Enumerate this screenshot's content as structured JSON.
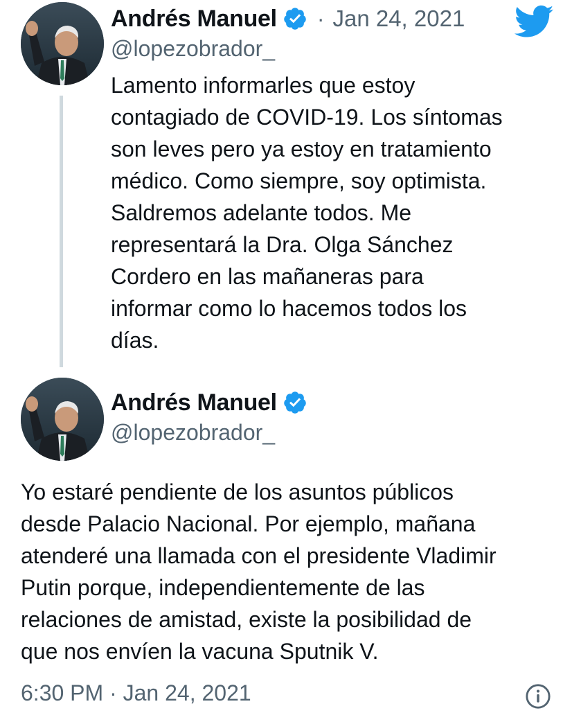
{
  "tweets": [
    {
      "display_name": "Andrés Manuel",
      "verified": true,
      "separator": "·",
      "date": "Jan 24, 2021",
      "handle": "@lopezobrador_",
      "avatar": "avatar-photo",
      "text": "Lamento informarles que estoy\ncontagiado de COVID-19. Los síntomas\nson leves pero ya estoy en tratamiento\nmédico. Como siempre, soy optimista.\nSaldremos adelante todos. Me\nrepresentará la Dra. Olga Sánchez\nCordero en las mañaneras para\ninformar como lo hacemos todos los\ndías."
    },
    {
      "display_name": "Andrés Manuel",
      "verified": true,
      "handle": "@lopezobrador_",
      "avatar": "avatar-photo",
      "text": "Yo estaré pendiente de los asuntos públicos\ndesde Palacio Nacional. Por ejemplo, mañana\natenderé una llamada con el presidente Vladimir\nPutin porque, independientemente de las\nrelaciones de amistad, existe la posibilidad de\nque nos envíen la vacuna Sputnik V."
    }
  ],
  "footer": {
    "timestamp": "6:30 PM · Jan 24, 2021"
  },
  "icons": {
    "brand": "twitter-bird-icon",
    "verified": "verified-badge-icon",
    "info": "info-icon"
  },
  "colors": {
    "twitter_blue": "#1d9bf0",
    "text_primary": "#0f1419",
    "text_secondary": "#536471",
    "thread_line": "#cfd9de"
  }
}
